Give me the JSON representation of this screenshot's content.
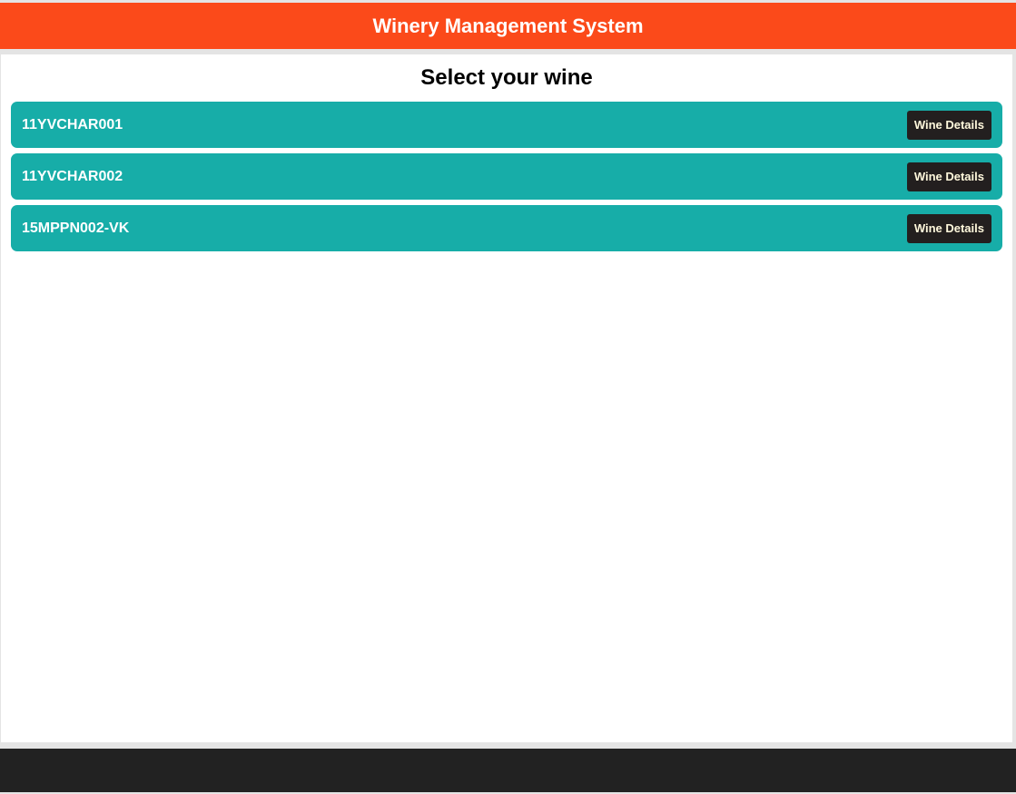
{
  "header": {
    "title": "Winery Management System"
  },
  "main": {
    "title": "Select your wine",
    "wines": [
      {
        "code": "11YVCHAR001",
        "button_label": "Wine Details"
      },
      {
        "code": "11YVCHAR002",
        "button_label": "Wine Details"
      },
      {
        "code": "15MPPN002-VK",
        "button_label": "Wine Details"
      }
    ]
  },
  "colors": {
    "header_bg": "#fb4a1a",
    "row_bg": "#17ada8",
    "button_bg": "#231f1f",
    "footer_bg": "#222222"
  }
}
